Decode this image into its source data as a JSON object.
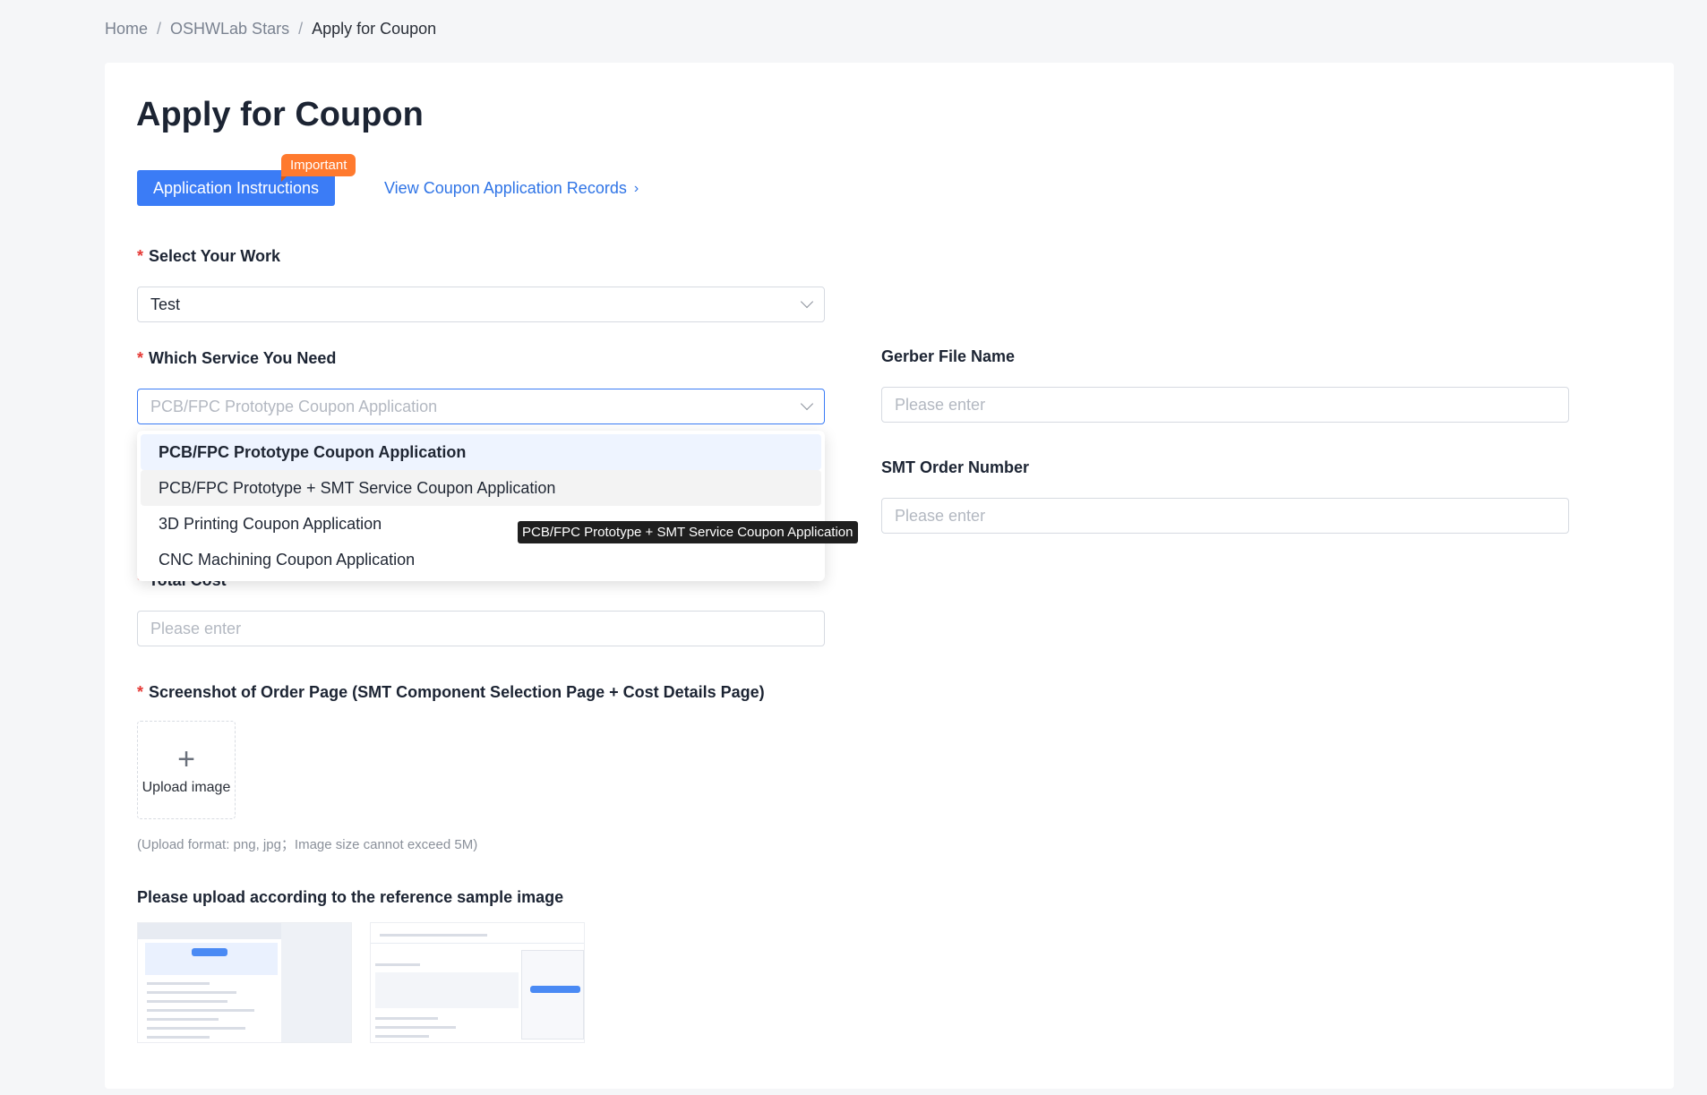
{
  "breadcrumb": {
    "home": "Home",
    "sep1": "/",
    "section": "OSHWLab Stars",
    "sep2": "/",
    "current": "Apply for Coupon"
  },
  "page": {
    "title": "Apply for Coupon"
  },
  "actions": {
    "instructions_label": "Application Instructions",
    "important_badge": "Important",
    "records_link": "View Coupon Application Records",
    "records_chevron": "›"
  },
  "form": {
    "required_mark": "*",
    "work": {
      "label": "Select Your Work",
      "value": "Test"
    },
    "service": {
      "label": "Which Service You Need",
      "placeholder": "PCB/FPC Prototype Coupon Application",
      "options": [
        "PCB/FPC Prototype Coupon Application",
        "PCB/FPC Prototype + SMT Service Coupon Application",
        "3D Printing Coupon Application",
        "CNC Machining Coupon Application"
      ],
      "tooltip": "PCB/FPC Prototype + SMT Service Coupon Application"
    },
    "gerber": {
      "label": "Gerber File Name",
      "placeholder": "Please enter"
    },
    "smt_order": {
      "label": "SMT Order Number",
      "placeholder": "Please enter"
    },
    "total_cost": {
      "label": "Total Cost",
      "placeholder": "Please enter"
    },
    "screenshot": {
      "label": "Screenshot of Order Page (SMT Component Selection Page + Cost Details Page)",
      "upload_icon": "plus-icon",
      "upload_label": "Upload image",
      "hint": "(Upload format: png, jpg；Image size cannot exceed 5M)"
    },
    "reference": {
      "label": "Please upload according to the reference sample image"
    }
  },
  "colors": {
    "primary": "#3b7cf6",
    "badge": "#ff7a2e",
    "required": "#e53935",
    "link": "#2f74e6"
  }
}
